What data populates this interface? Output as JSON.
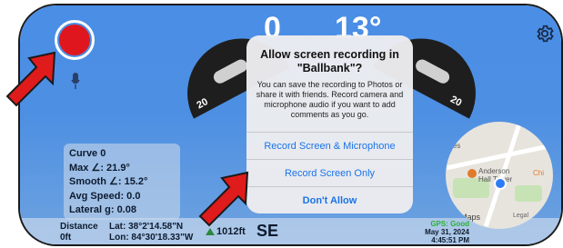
{
  "gauges": {
    "left_value": "0",
    "right_value": "13°",
    "left_tick": "20",
    "right_tick": "20"
  },
  "record_button": {
    "state": "recording",
    "color": "#e0161e"
  },
  "stats": {
    "curve": "Curve 0",
    "max": "Max ∠: 21.9°",
    "smooth": "Smooth ∠: 15.2°",
    "avg_speed": "Avg Speed: 0.0",
    "lateral": "Lateral g: 0.08"
  },
  "bottom_bar": {
    "distance_label": "Distance",
    "distance_value": "0ft",
    "lat": "Lat: 38°2'14.58\"N",
    "lon": "Lon: 84°30'18.33\"W",
    "altitude": "1012ft",
    "heading": "SE",
    "gps_status": "GPS: Good",
    "date": "May 31, 2024",
    "time": "4:45:51 PM"
  },
  "map": {
    "label_1": "Anderson",
    "label_2": "Hall Tower",
    "label_3": "Chi",
    "label_4": "ies",
    "maps_label": "Maps",
    "legal_label": "Legal"
  },
  "dialog": {
    "title": "Allow screen recording in \"Ballbank\"?",
    "message": "You can save the recording to Photos or share it with friends. Record camera and microphone audio if you want to add comments as you go.",
    "button_1": "Record Screen & Microphone",
    "button_2": "Record Screen Only",
    "button_3": "Don't Allow"
  },
  "colors": {
    "background_blue": "#4a8ee6",
    "accent_blue": "#1a73e8",
    "arrow_red": "#e01b1b",
    "gps_green": "#27b331"
  }
}
